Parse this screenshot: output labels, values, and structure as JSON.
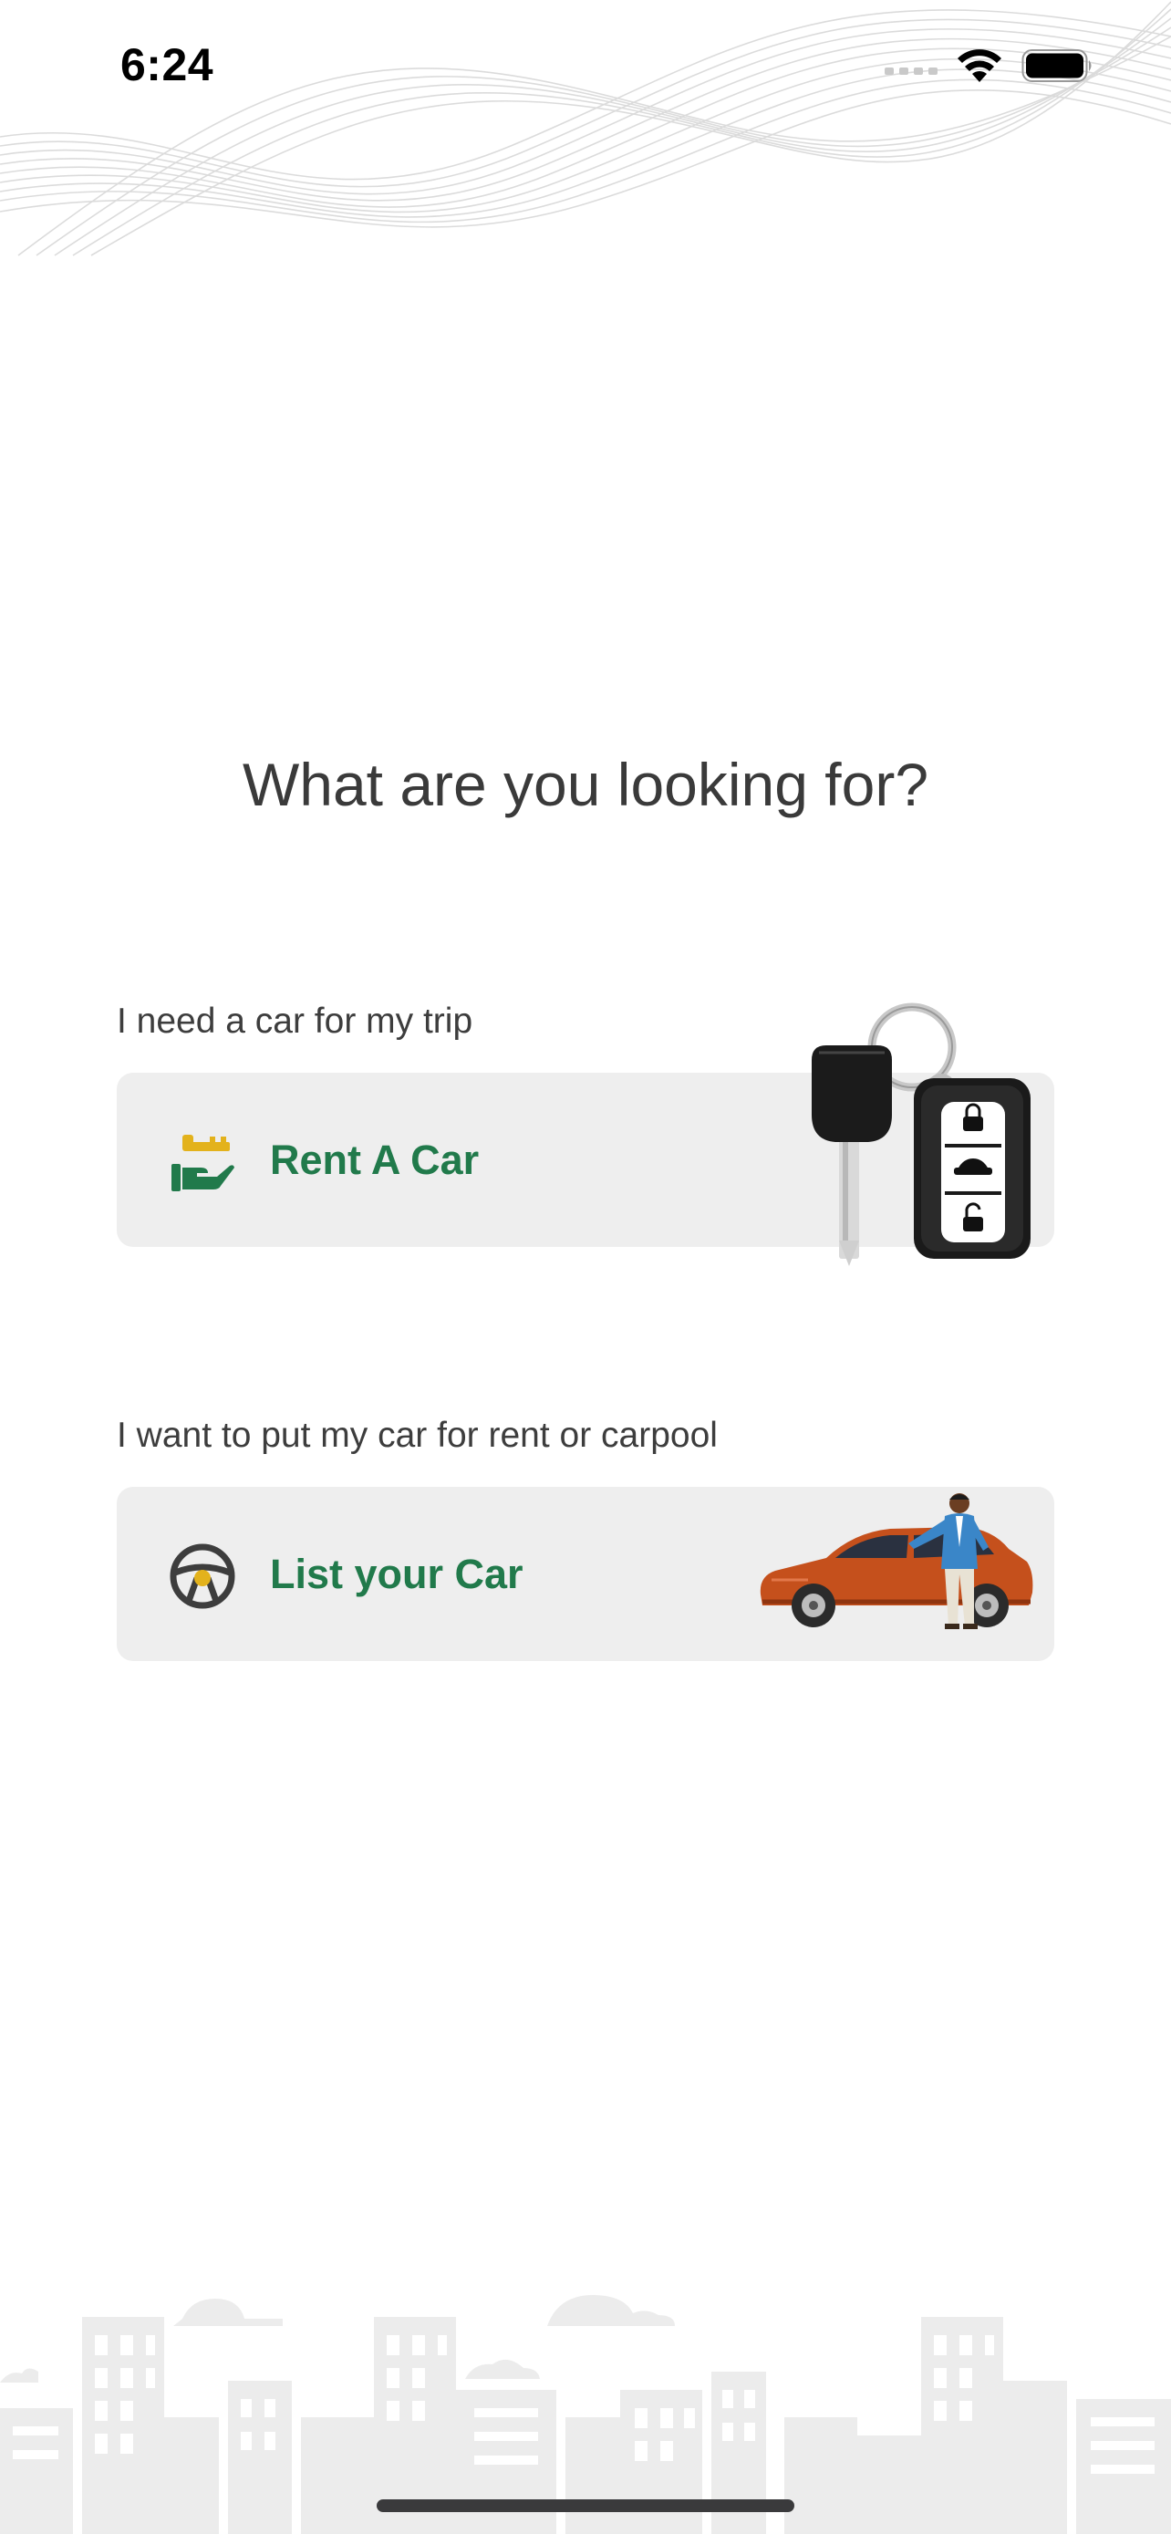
{
  "status_bar": {
    "time": "6:24"
  },
  "title": "What are you looking for?",
  "options": [
    {
      "caption": "I need a car for my trip",
      "label": "Rent A Car",
      "icon": "hand-key-icon",
      "illustration": "car-key-fob-illustration"
    },
    {
      "caption": "I want to put my car for rent or carpool",
      "label": "List your Car",
      "icon": "steering-wheel-icon",
      "illustration": "man-with-orange-car-illustration"
    }
  ],
  "colors": {
    "background": "#ffffff",
    "card_background": "#eeeeee",
    "accent_green": "#217a4b",
    "accent_yellow": "#e3b21c",
    "title_text": "#3a3a3a",
    "caption_text": "#3d3d3d",
    "decoration_gray": "#e6e6e6"
  }
}
